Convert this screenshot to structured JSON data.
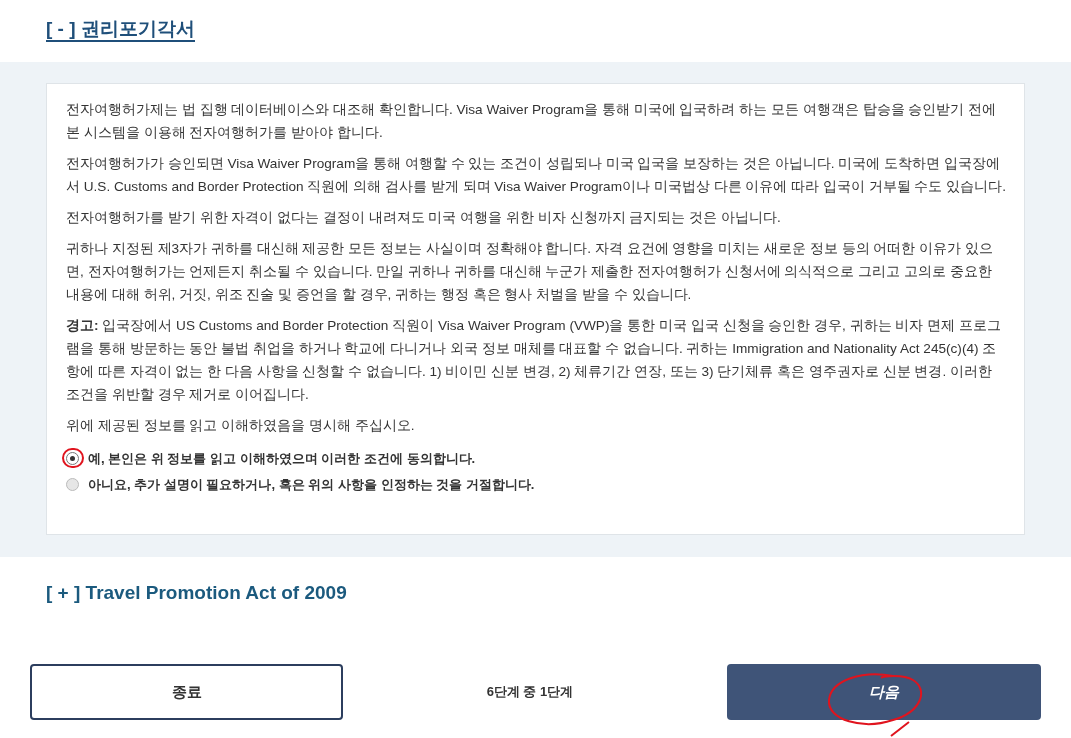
{
  "sections": [
    {
      "toggle": "[ - ]",
      "title": "권리포기각서",
      "expanded": true
    },
    {
      "toggle": "[ + ]",
      "title": "Travel Promotion Act of 2009",
      "expanded": false
    }
  ],
  "paragraphs": [
    "전자여행허가제는 법 집행 데이터베이스와 대조해 확인합니다. Visa Waiver Program을 통해 미국에 입국하려 하는 모든 여행객은 탑승을 승인받기 전에 본 시스템을 이용해 전자여행허가를 받아야 합니다.",
    "전자여행허가가 승인되면 Visa Waiver Program을 통해 여행할 수 있는 조건이 성립되나 미국 입국을 보장하는 것은 아닙니다. 미국에 도착하면 입국장에서 U.S. Customs and Border Protection 직원에 의해 검사를 받게 되며 Visa Waiver Program이나 미국법상 다른 이유에 따라 입국이 거부될 수도 있습니다.",
    "전자여행허가를 받기 위한 자격이 없다는 결정이 내려져도 미국 여행을 위한 비자 신청까지 금지되는 것은 아닙니다.",
    "귀하나 지정된 제3자가 귀하를 대신해 제공한 모든 정보는 사실이며 정확해야 합니다. 자격 요건에 영향을 미치는 새로운 정보 등의 어떠한 이유가 있으면, 전자여행허가는 언제든지 취소될 수 있습니다. 만일 귀하나 귀하를 대신해 누군가 제출한 전자여행허가 신청서에 의식적으로 그리고 고의로 중요한 내용에 대해 허위, 거짓, 위조 진술 및 증언을 할 경우, 귀하는 행정 혹은 형사 처벌을 받을 수 있습니다.",
    "**경고:** 입국장에서 US Customs and Border Protection 직원이 Visa Waiver Program (VWP)을 통한 미국 입국 신청을 승인한 경우, 귀하는 비자 면제 프로그램을 통해 방문하는 동안 불법 취업을 하거나 학교에 다니거나 외국 정보 매체를 대표할 수 없습니다. 귀하는 Immigration and Nationality Act 245(c)(4) 조항에 따른 자격이 없는 한 다음 사항을 신청할 수 없습니다. 1) 비이민 신분 변경, 2) 체류기간 연장, 또는 3) 단기체류 혹은 영주권자로 신분 변경. 이러한 조건을 위반할 경우 제거로 이어집니다.",
    "위에 제공된 정보를 읽고 이해하였음을 명시해 주십시오."
  ],
  "options": [
    {
      "label": "예, 본인은 위 정보를 읽고 이해하였으며 이러한 조건에 동의합니다.",
      "selected": true,
      "circled": true
    },
    {
      "label": "아니요, 추가 설명이 필요하거나, 혹은 위의 사항을 인정하는 것을 거절합니다.",
      "selected": false,
      "circled": false
    }
  ],
  "footer": {
    "exit_button": "종료",
    "step": "6단계 중 1단계",
    "next_button": "다음",
    "next_circled": true
  }
}
